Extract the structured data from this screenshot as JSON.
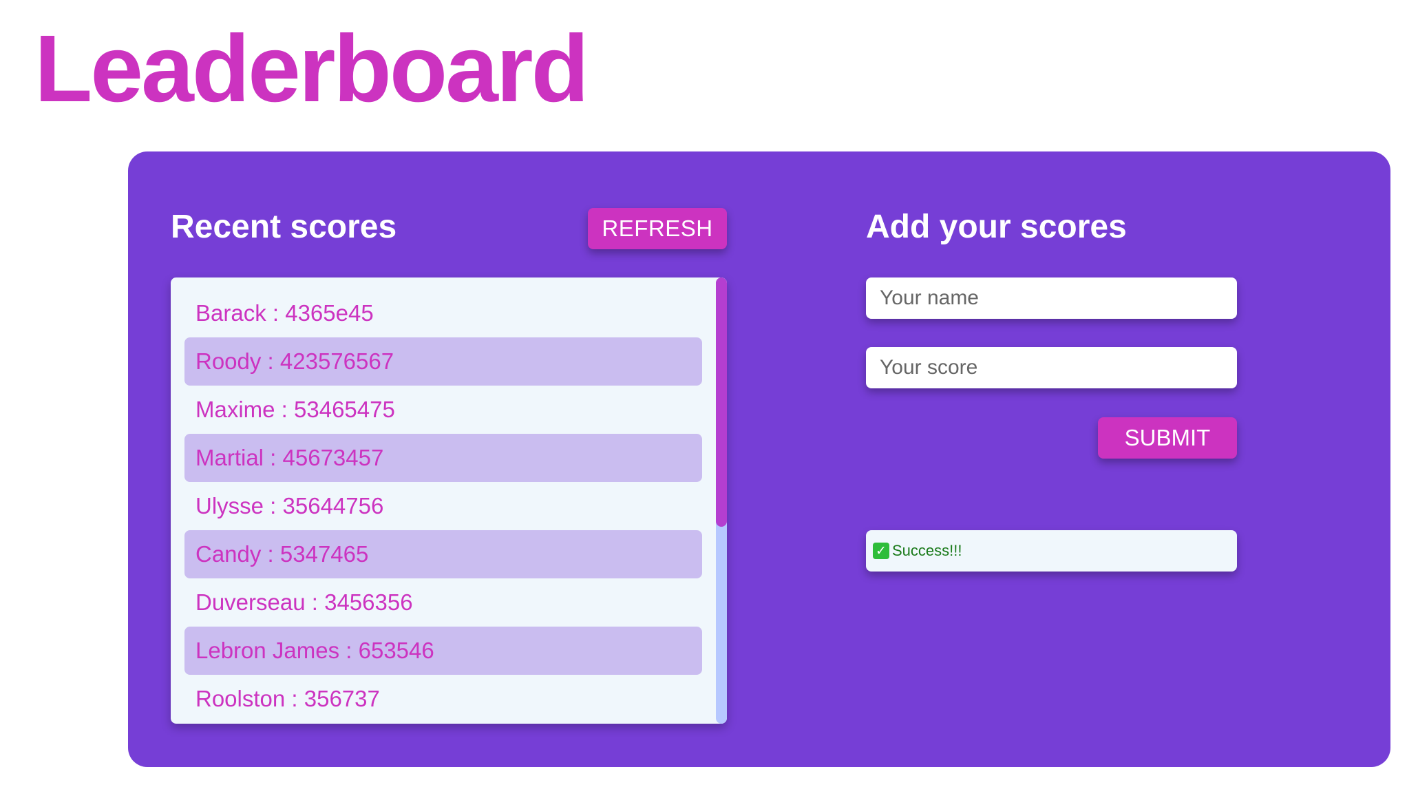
{
  "page": {
    "title": "Leaderboard"
  },
  "recent": {
    "heading": "Recent scores",
    "refresh_label": "REFRESH",
    "scores": [
      "Barack : 4365e45",
      "Roody : 423576567",
      "Maxime : 53465475",
      "Martial : 45673457",
      "Ulysse : 35644756",
      "Candy : 5347465",
      "Duverseau : 3456356",
      "Lebron James : 653546",
      "Roolston : 356737"
    ]
  },
  "form": {
    "heading": "Add your scores",
    "name_placeholder": "Your name",
    "name_value": "",
    "score_placeholder": "Your score",
    "score_value": "",
    "submit_label": "SUBMIT"
  },
  "status": {
    "icon": "check-icon",
    "message": "Success!!!"
  },
  "colors": {
    "accent": "#cc33c0",
    "panel": "#763ed6",
    "row_alt": "#cabdf0",
    "list_bg": "#f0f7fc",
    "success_text": "#1a7a1a",
    "success_icon": "#2ebd3a"
  }
}
